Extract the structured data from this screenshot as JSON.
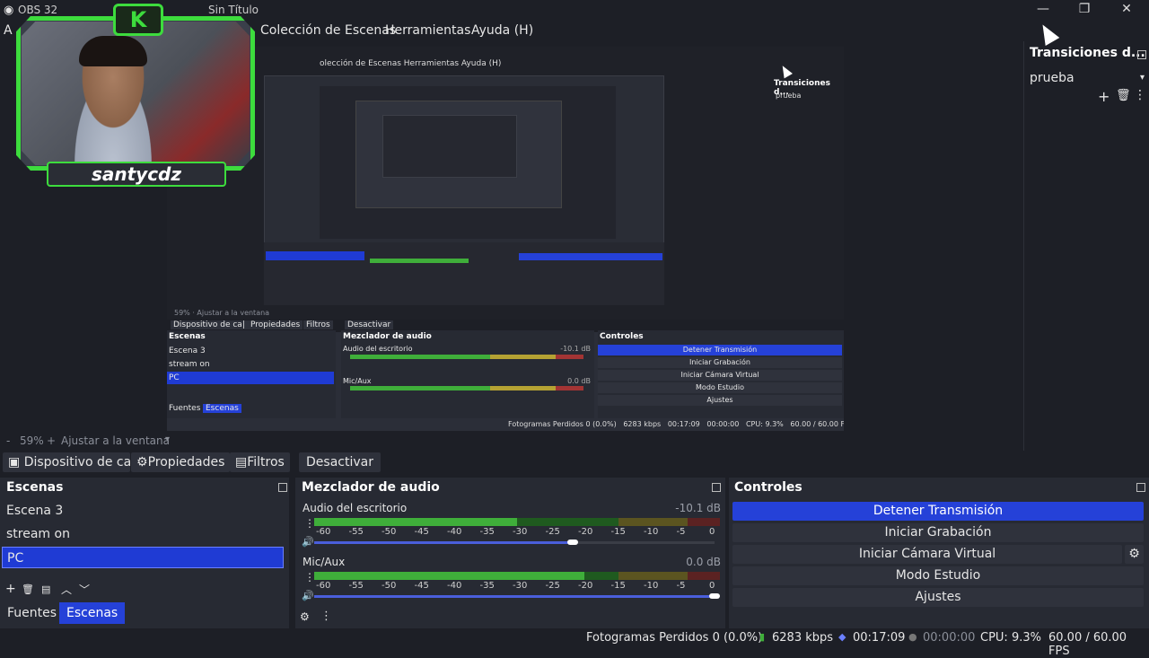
{
  "window": {
    "title_fragment": "OBS 32",
    "title_suffix": "Sin Título"
  },
  "menu": {
    "items": [
      "Colección de Escenas",
      "Herramientas",
      "Ayuda (H)"
    ],
    "partial_left": "A"
  },
  "webcam": {
    "badge": "K",
    "name": "santycdz"
  },
  "nested_preview": {
    "menu_items": "olección de Escenas  Herramientas  Ayuda (H)",
    "transitions_title": "Transiciones d...",
    "transition_value": "prueba",
    "zoom": "59%  ·  Ajustar a la ventana",
    "toolbar": [
      "Dispositivo de ca|",
      "Propiedades",
      "Filtros",
      "Desactivar"
    ],
    "scenes_title": "Escenas",
    "scenes": [
      "Escena 3",
      "stream on",
      "PC"
    ],
    "mixer_title": "Mezclador de audio",
    "mixer_channels": [
      {
        "name": "Audio del escritorio",
        "db": "-10.1 dB"
      },
      {
        "name": "Mic/Aux",
        "db": "0.0 dB"
      }
    ],
    "controls_title": "Controles",
    "controls": [
      "Detener Transmisión",
      "Iniciar Grabación",
      "Iniciar Cámara Virtual",
      "Modo Estudio",
      "Ajustes"
    ],
    "tabs": [
      "Fuentes",
      "Escenas"
    ],
    "status": "Fotogramas Perdidos 0 (0.0%)   6283 kbps   00:17:09   00:00:00   CPU: 9.3%   60.00 / 60.00 FPS"
  },
  "transitions": {
    "title": "Transiciones d...",
    "value": "prueba"
  },
  "zoom": {
    "percent": "59%",
    "label": "Ajustar a la ventana"
  },
  "source_toolbar": {
    "device": "Dispositivo de ca|",
    "properties": "Propiedades",
    "filters": "Filtros",
    "deactivate": "Desactivar"
  },
  "scenes": {
    "title": "Escenas",
    "items": [
      "Escena 3",
      "stream on",
      "PC"
    ],
    "selected_index": 2
  },
  "tabs": {
    "sources": "Fuentes",
    "scenes": "Escenas"
  },
  "mixer": {
    "title": "Mezclador de audio",
    "ticks": [
      "-60",
      "-55",
      "-50",
      "-45",
      "-40",
      "-35",
      "-30",
      "-25",
      "-20",
      "-15",
      "-10",
      "-5",
      "0"
    ],
    "channels": [
      {
        "name": "Audio del escritorio",
        "db": "-10.1 dB",
        "level_db": -30,
        "volume": 0.64
      },
      {
        "name": "Mic/Aux",
        "db": "0.0 dB",
        "level_db": -20,
        "volume": 1.0
      }
    ]
  },
  "controls": {
    "title": "Controles",
    "stop_stream": "Detener Transmisión",
    "start_recording": "Iniciar Grabación",
    "virtual_cam": "Iniciar Cámara Virtual",
    "studio_mode": "Modo Estudio",
    "settings": "Ajustes"
  },
  "status": {
    "dropped": "Fotogramas Perdidos 0 (0.0%)",
    "bitrate": "6283 kbps",
    "stream_time": "00:17:09",
    "rec_time": "00:00:00",
    "cpu": "CPU: 9.3%",
    "fps": "60.00 / 60.00 FPS"
  },
  "colors": {
    "accent": "#2541d8",
    "meter_green": "#3fae3a",
    "meter_yellow": "#b5a233",
    "meter_red": "#a33434",
    "cam_border": "#3ddc3d"
  }
}
